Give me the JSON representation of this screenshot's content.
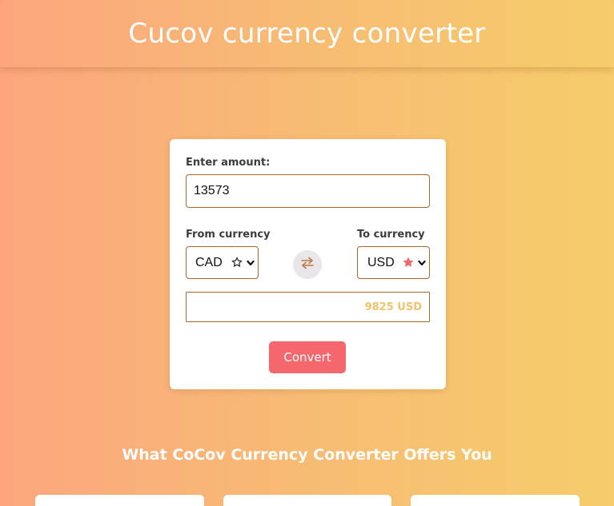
{
  "header": {
    "title": "Cucov currency converter"
  },
  "converter": {
    "amount_label": "Enter amount:",
    "amount_value": "13573",
    "from_label": "From currency",
    "from_value": "CAD",
    "from_favorite": false,
    "to_label": "To currency",
    "to_value": "USD",
    "to_favorite": true,
    "swap_icon": "swap-arrows-icon",
    "result": "9825 USD",
    "convert_label": "Convert"
  },
  "offers": {
    "heading": "What CoCov Currency Converter Offers You"
  },
  "colors": {
    "accent": "#f4676d",
    "border": "#a8652e",
    "result_text": "#f3c36a",
    "favorite_star": "#f4676d"
  }
}
